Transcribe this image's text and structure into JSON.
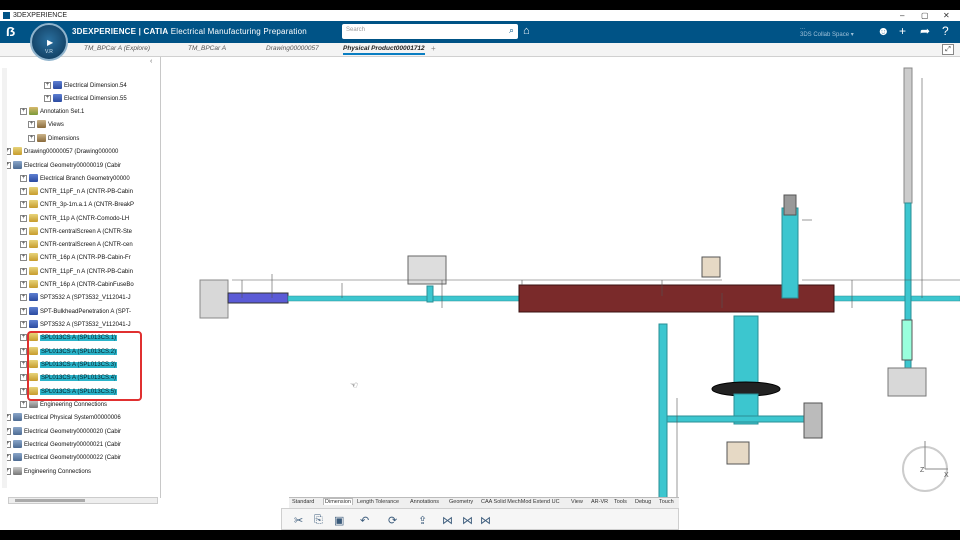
{
  "window": {
    "title": "3DEXPERIENCE",
    "controls": [
      "–",
      "▢",
      "✕"
    ]
  },
  "app": {
    "brand": "3DEXPERIENCE | CATIA",
    "module": "Electrical Manufacturing Preparation",
    "compass_version": "V.R",
    "search_placeholder": "Search",
    "collab_line1": "...",
    "collab_line2": "3DS Collab Space ▾"
  },
  "tabs": [
    {
      "label": "TM_BPCar A (Explore)",
      "active": false
    },
    {
      "label": "TM_BPCar A",
      "active": false
    },
    {
      "label": "Drawing00000057",
      "active": false
    },
    {
      "label": "Physical Product00001712",
      "active": true
    }
  ],
  "tree": {
    "rows": [
      {
        "label": "Electrical Dimension.54",
        "icon": "blue"
      },
      {
        "label": "Electrical Dimension.55",
        "icon": "blue"
      },
      {
        "label": "Annotation Set.1",
        "icon": "ann"
      },
      {
        "label": "Views",
        "icon": "view"
      },
      {
        "label": "Dimensions",
        "icon": "view"
      },
      {
        "label": "Drawing00000057 (Drawing000000",
        "icon": "doc"
      },
      {
        "label": "Electrical Geometry00000019 (Cabir",
        "icon": "geo"
      },
      {
        "label": "Electrical Branch Geometry00000",
        "icon": "blue"
      },
      {
        "label": "CNTR_11pF_n A (CNTR-PB-Cabin",
        "icon": "doc"
      },
      {
        "label": "CNTR_3p-1m.a.1 A (CNTR-BreakP",
        "icon": "doc"
      },
      {
        "label": "CNTR_11p A (CNTR-Comodo-LH",
        "icon": "doc"
      },
      {
        "label": "CNTR-centralScreen A (CNTR-Ste",
        "icon": "doc"
      },
      {
        "label": "CNTR-centralScreen A (CNTR-cen",
        "icon": "doc"
      },
      {
        "label": "CNTR_16p A (CNTR-PB-Cabin-Fr",
        "icon": "doc"
      },
      {
        "label": "CNTR_11pF_n A (CNTR-PB-Cabin",
        "icon": "doc"
      },
      {
        "label": "CNTR_16p A (CNTR-CabinFuseBo",
        "icon": "doc"
      },
      {
        "label": "SPT3532 A (SPT3532_V112041-J",
        "icon": "blue"
      },
      {
        "label": "SPT-BulkheadPenetration A (SPT-",
        "icon": "blue"
      },
      {
        "label": "SPT3532 A (SPT3532_V112041-J",
        "icon": "blue"
      },
      {
        "label": "SPL013CS A (SPL013CS.1)",
        "icon": "doc",
        "highlight": true
      },
      {
        "label": "SPL013CS A (SPL013CS.2)",
        "icon": "doc",
        "highlight": true
      },
      {
        "label": "SPL013CS A (SPL013CS.3)",
        "icon": "doc",
        "highlight": true
      },
      {
        "label": "SPL013CS A (SPL013CS.4)",
        "icon": "doc",
        "highlight": true
      },
      {
        "label": "SPL013CS A (SPL013CS.5)",
        "icon": "doc",
        "highlight": true
      },
      {
        "label": "Engineering Connections",
        "icon": "conn"
      },
      {
        "label": "Electrical Physical System00000006",
        "icon": "geo"
      },
      {
        "label": "Electrical Geometry00000020 (Cabir",
        "icon": "geo"
      },
      {
        "label": "Electrical Geometry00000021 (Cabir",
        "icon": "geo"
      },
      {
        "label": "Electrical Geometry00000022 (Cabir",
        "icon": "geo"
      },
      {
        "label": "Engineering Connections",
        "icon": "conn"
      }
    ]
  },
  "toolbar": {
    "tabs": [
      "Standard",
      "Dimension",
      "Length Tolerance",
      "Annotations",
      "Geometry",
      "CAA Solid MechMod Extend UC",
      "View",
      "AR-VR",
      "Tools",
      "Debug",
      "Touch"
    ],
    "active_tab": "Dimension",
    "icons": [
      "scissors-icon",
      "copy-icon",
      "paste-icon",
      "undo-icon",
      "update-icon",
      "export-icon",
      "dimension-icon-1",
      "dimension-icon-2",
      "dimension-icon-3"
    ]
  },
  "axis": {
    "z": "Z",
    "x": "X"
  },
  "colors": {
    "brand": "#005386",
    "cable": "#3cc6cf",
    "branch": "#7a2a2a",
    "highlight": "#2bb3c9",
    "callout": "#e03030"
  }
}
